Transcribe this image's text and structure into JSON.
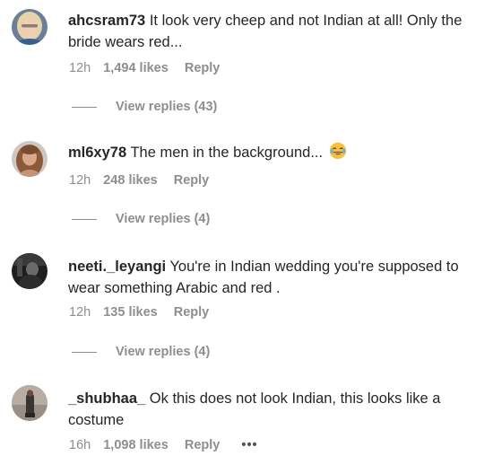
{
  "comments": [
    {
      "username": "ahcsram73",
      "text": "It look very cheep and not Indian at all! Only the bride wears red...",
      "time": "12h",
      "likes": "1,494 likes",
      "reply": "Reply",
      "view_replies": "View replies (43)",
      "avatar_icon": "avatar-blonde-woman"
    },
    {
      "username": "ml6xy78",
      "text": "The men in the background...",
      "emoji": "laughing-crying-emoji",
      "time": "12h",
      "likes": "248 likes",
      "reply": "Reply",
      "view_replies": "View replies (4)",
      "avatar_icon": "avatar-woman-long-hair"
    },
    {
      "username": "neeti._leyangi",
      "text": "You're in Indian wedding you're supposed to wear something Arabic and red .",
      "time": "12h",
      "likes": "135 likes",
      "reply": "Reply",
      "view_replies": "View replies (4)",
      "avatar_icon": "avatar-dark-photo"
    },
    {
      "username": "_shubhaa_",
      "text": "Ok this does not look Indian, this looks like a costume",
      "time": "16h",
      "likes": "1,098 likes",
      "reply": "Reply",
      "more": "•••",
      "avatar_icon": "avatar-standing-figure"
    }
  ],
  "colors": {
    "text": "#262626",
    "secondary": "#8e8e8e",
    "background": "#ffffff"
  }
}
